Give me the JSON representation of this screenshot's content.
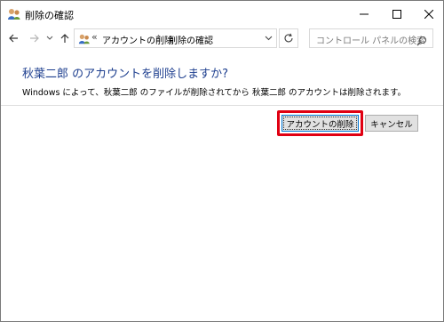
{
  "window": {
    "title": "削除の確認",
    "controls": [
      "minimize",
      "maximize",
      "close"
    ]
  },
  "navigation": {
    "address": {
      "overflow": "«",
      "breadcrumbs": [
        "アカウントの削除",
        "削除の確認"
      ],
      "separator": "›"
    },
    "search_placeholder": "コントロール パネルの検索"
  },
  "content": {
    "heading": "秋葉二郎 のアカウントを削除しますか?",
    "description": "Windows によって、秋葉二郎 のファイルが削除されてから 秋葉二郎 のアカウントは削除されます。"
  },
  "buttons": {
    "delete_label": "アカウントの削除",
    "cancel_label": "キャンセル"
  },
  "colors": {
    "heading": "#1e3f8f",
    "highlight": "#e00012",
    "focus_border": "#0078d7"
  }
}
